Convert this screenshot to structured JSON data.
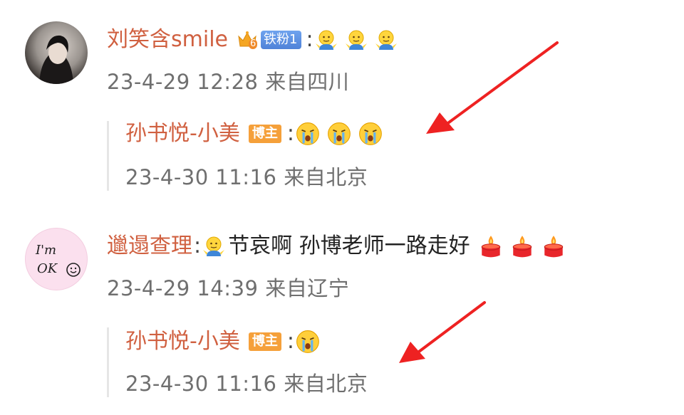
{
  "comments": [
    {
      "username": "刘笑含smile",
      "fan_badge": "铁粉1",
      "fan_badge_level": "6",
      "emojis": [
        "shrug-emoji",
        "shrug-emoji",
        "shrug-emoji"
      ],
      "meta": "23-4-29 12:28 来自四川",
      "reply": {
        "username": "孙书悦-小美",
        "badge": "博主",
        "emojis": [
          "crying-emoji",
          "crying-emoji",
          "crying-emoji"
        ],
        "meta": "23-4-30 11:16 来自北京"
      }
    },
    {
      "username": "邋遢查理",
      "avatar_text": [
        "I'm",
        "OK"
      ],
      "text": "节哀啊 孙博老师一路走好",
      "emojis_lead": [
        "shrug-emoji"
      ],
      "emojis_trail": [
        "candle-emoji",
        "candle-emoji",
        "candle-emoji"
      ],
      "meta": "23-4-29 14:39 来自辽宁",
      "reply": {
        "username": "孙书悦-小美",
        "badge": "博主",
        "emojis": [
          "crying-emoji"
        ],
        "meta": "23-4-30 11:16 来自北京"
      }
    }
  ],
  "colors": {
    "username": "#d06040",
    "meta": "#6f6f6f",
    "arrow": "#ee2222",
    "badge_blogger": "#f5a03a"
  }
}
